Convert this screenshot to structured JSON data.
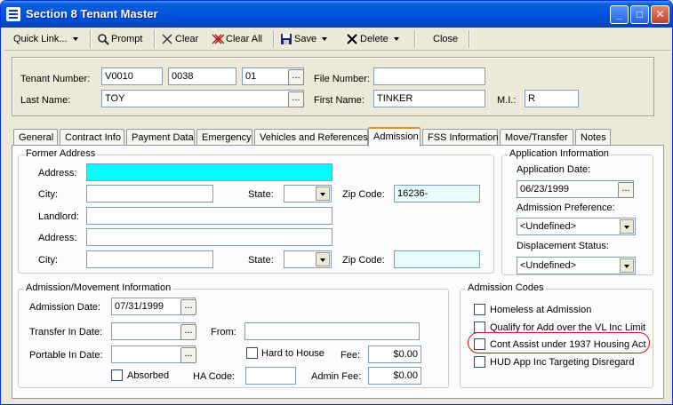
{
  "window": {
    "title": "Section 8 Tenant Master"
  },
  "toolbar": {
    "quick_link": "Quick Link...",
    "prompt": "Prompt",
    "clear": "Clear",
    "clear_all": "Clear All",
    "save": "Save",
    "delete": "Delete",
    "close": "Close"
  },
  "header": {
    "tenant_number_label": "Tenant Number:",
    "tenant_number_1": "V0010",
    "tenant_number_2": "0038",
    "tenant_number_3": "01",
    "file_number_label": "File Number:",
    "file_number": "",
    "last_name_label": "Last Name:",
    "last_name": "TOY",
    "first_name_label": "First Name:",
    "first_name": "TINKER",
    "mi_label": "M.I.:",
    "mi": "R"
  },
  "tabs": [
    "General",
    "Contract Info",
    "Payment Data",
    "Emergency",
    "Vehicles and References",
    "Admission",
    "FSS Information",
    "Move/Transfer",
    "Notes"
  ],
  "former_address": {
    "title": "Former Address",
    "address_label": "Address:",
    "address": "",
    "city_label": "City:",
    "city": "",
    "state_label": "State:",
    "state": "",
    "zip_label": "Zip Code:",
    "zip": "16236-",
    "landlord_label": "Landlord:",
    "landlord": "",
    "address2_label": "Address:",
    "address2": "",
    "city2_label": "City:",
    "city2": "",
    "state2_label": "State:",
    "state2": "",
    "zip2_label": "Zip Code:",
    "zip2": ""
  },
  "application_info": {
    "title": "Application Information",
    "date_label": "Application Date:",
    "date": "06/23/1999",
    "pref_label": "Admission Preference:",
    "pref": "<Undefined>",
    "disp_label": "Displacement Status:",
    "disp": "<Undefined>"
  },
  "movement": {
    "title": "Admission/Movement Information",
    "adm_date_label": "Admission Date:",
    "adm_date": "07/31/1999",
    "transfer_label": "Transfer In Date:",
    "transfer": "",
    "from_label": "From:",
    "from": "",
    "portable_label": "Portable In Date:",
    "portable": "",
    "hard_label": "Hard to House",
    "fee_label": "Fee:",
    "fee": "$0.00",
    "absorbed_label": "Absorbed",
    "ha_code_label": "HA Code:",
    "ha_code": "",
    "admin_fee_label": "Admin Fee:",
    "admin_fee": "$0.00"
  },
  "admission_codes": {
    "title": "Admission Codes",
    "items": [
      "Homeless at Admission",
      "Qualify for Add over the VL Inc Limit",
      "Cont Assist under 1937 Housing Act",
      "HUD App Inc Targeting Disregard"
    ]
  },
  "colors": {
    "title_bar": "#0054e3",
    "highlight_field": "#00ffff",
    "annotation_circle": "#e01010"
  },
  "icons": [
    "app-icon",
    "caret-icon",
    "search-icon",
    "clear-icon",
    "clear-all-icon",
    "save-icon",
    "delete-icon",
    "minimize-icon",
    "maximize-icon",
    "close-icon",
    "ellipsis-icon",
    "dropdown-arrow-icon"
  ]
}
